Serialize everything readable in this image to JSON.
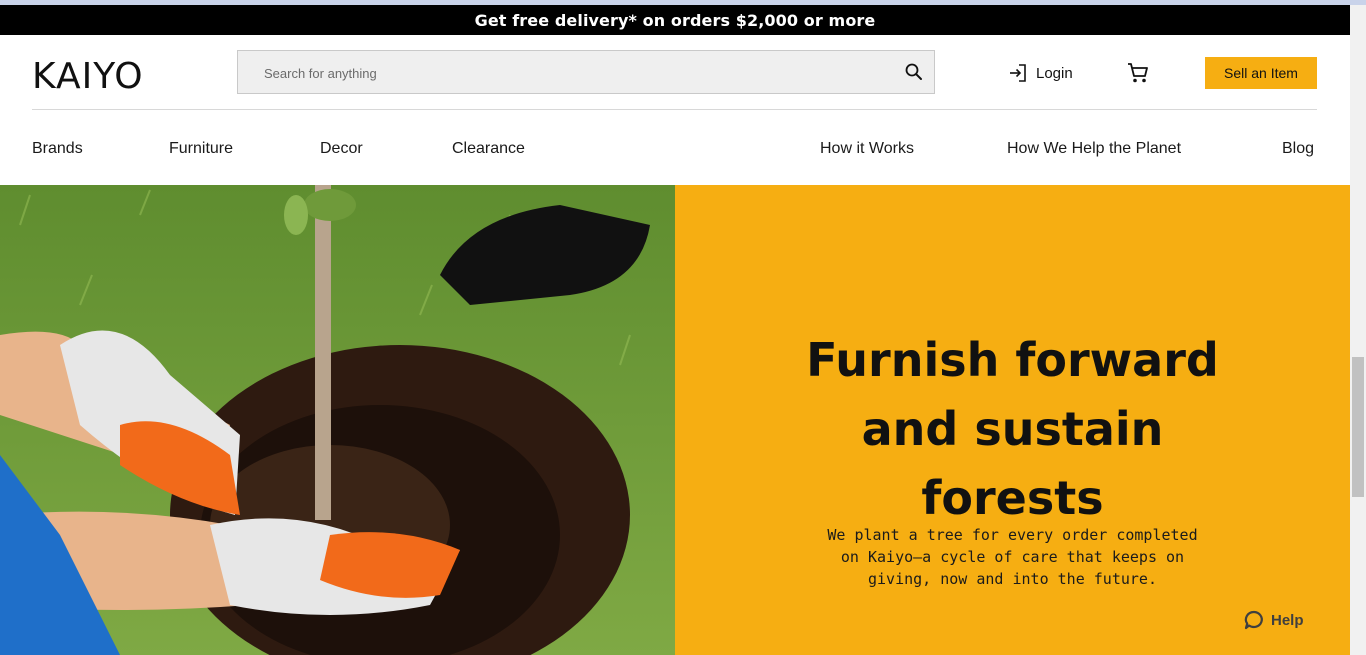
{
  "promo": {
    "text": "Get free delivery* on orders $2,000 or more"
  },
  "header": {
    "logo_text": "KAIYO",
    "search": {
      "placeholder": "Search for anything",
      "value": ""
    },
    "login_label": "Login",
    "sell_label": "Sell an Item"
  },
  "nav": {
    "left": [
      "Brands",
      "Furniture",
      "Decor",
      "Clearance"
    ],
    "right": [
      "How it Works",
      "How We Help the Planet",
      "Blog"
    ]
  },
  "hero": {
    "title_lines": [
      "Furnish forward",
      "and sustain",
      "forests"
    ],
    "subtitle_lines": [
      "We plant a tree for every order completed",
      "on Kaiyo—a cycle of care that keeps on",
      "giving, now and into the future."
    ]
  },
  "help_label": "Help",
  "colors": {
    "accent": "#f6ae12",
    "promo_bg": "#000000"
  },
  "icons": [
    "search-icon",
    "login-icon",
    "cart-icon",
    "chat-icon"
  ]
}
